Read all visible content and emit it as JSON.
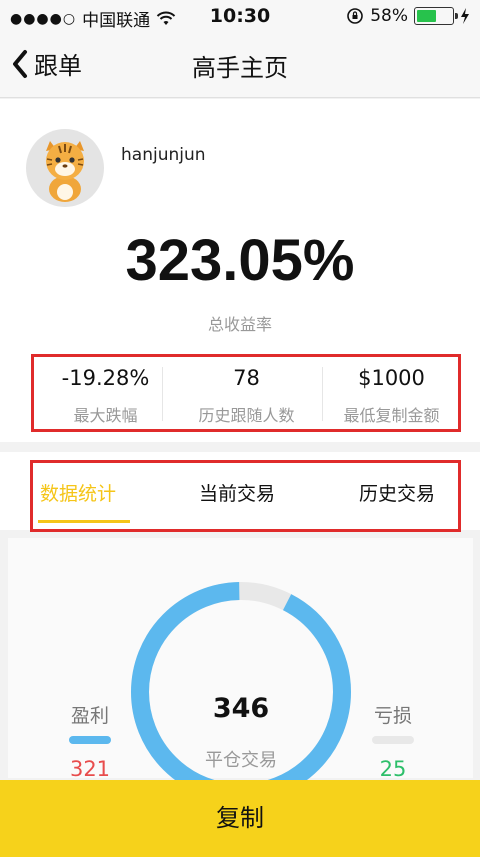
{
  "status_bar": {
    "signal": "●●●●○",
    "carrier": "中国联通",
    "time": "10:30",
    "battery": "58%",
    "battery_level": 0.58
  },
  "nav": {
    "back_label": "跟单",
    "title": "高手主页"
  },
  "profile": {
    "username": "hanjunjun",
    "total_return": "323.05%",
    "total_return_label": "总收益率"
  },
  "stats": [
    {
      "value": "-19.28%",
      "label": "最大跌幅"
    },
    {
      "value": "78",
      "label": "历史跟随人数"
    },
    {
      "value": "$1000",
      "label": "最低复制金额"
    }
  ],
  "tabs": [
    {
      "label": "数据统计",
      "active": true
    },
    {
      "label": "当前交易",
      "active": false
    },
    {
      "label": "历史交易",
      "active": false
    }
  ],
  "summary": {
    "total": "346",
    "total_label": "平仓交易",
    "profit_label": "盈利",
    "profit_value": "321",
    "loss_label": "亏损",
    "loss_value": "25",
    "profit_count": 321,
    "loss_count": 25
  },
  "colors": {
    "accent": "#f6d21b",
    "tab_active": "#f5c518",
    "profit_ring": "#5cb8ee",
    "loss_ring": "#e8e8e8",
    "profit_text": "#e84c4c",
    "loss_text": "#2dbf6a",
    "highlight_box": "#e02b2b"
  },
  "footer": {
    "copy_label": "复制"
  }
}
